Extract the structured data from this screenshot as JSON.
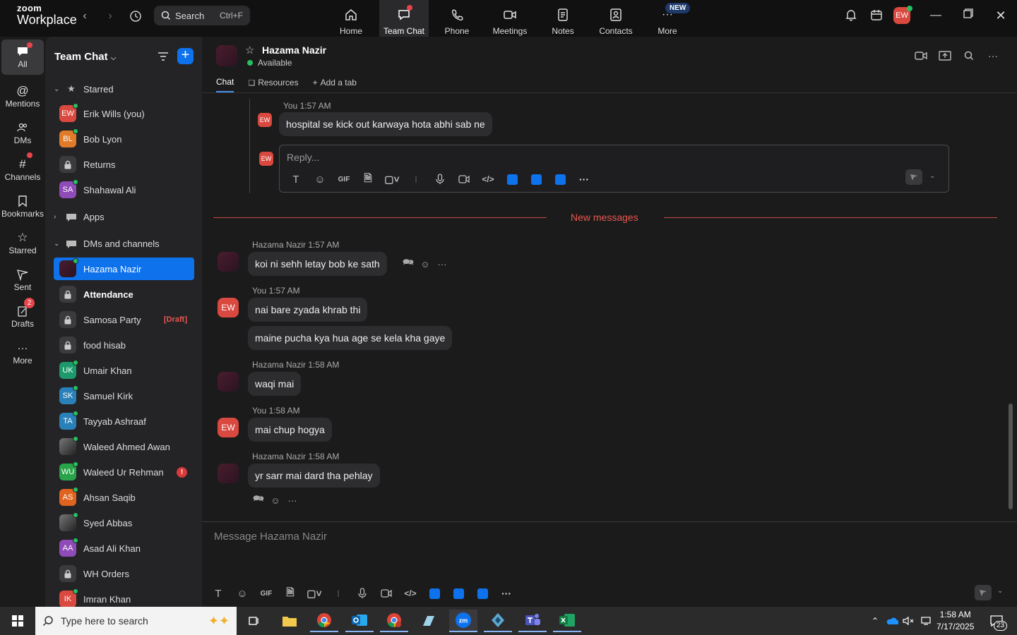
{
  "app": {
    "logo_line1": "zoom",
    "logo_line2": "Workplace"
  },
  "topbar": {
    "search_label": "Search",
    "search_shortcut": "Ctrl+F",
    "tabs": [
      {
        "label": "Home",
        "icon": "home-icon"
      },
      {
        "label": "Team Chat",
        "icon": "chat-icon"
      },
      {
        "label": "Phone",
        "icon": "phone-icon"
      },
      {
        "label": "Meetings",
        "icon": "video-icon"
      },
      {
        "label": "Notes",
        "icon": "notes-icon"
      },
      {
        "label": "Contacts",
        "icon": "contacts-icon"
      },
      {
        "label": "More",
        "icon": "more-icon"
      }
    ],
    "new_badge": "NEW",
    "user_initials": "EW"
  },
  "rail": {
    "items": [
      {
        "label": "All",
        "icon": "chat-bubble-icon"
      },
      {
        "label": "Mentions",
        "icon": "at-icon"
      },
      {
        "label": "DMs",
        "icon": "people-icon"
      },
      {
        "label": "Channels",
        "icon": "hash-icon"
      },
      {
        "label": "Bookmarks",
        "icon": "bookmark-icon"
      },
      {
        "label": "Starred",
        "icon": "star-icon"
      },
      {
        "label": "Sent",
        "icon": "send-icon"
      },
      {
        "label": "Drafts",
        "icon": "draft-icon"
      },
      {
        "label": "More",
        "icon": "ellipsis-icon"
      }
    ],
    "drafts_count": "2"
  },
  "sidebar": {
    "title": "Team Chat",
    "sections": {
      "starred": "Starred",
      "apps": "Apps",
      "dms": "DMs and channels"
    },
    "starred_items": [
      {
        "label": "Erik Wills (you)",
        "initials": "EW",
        "color": "#d9493f"
      },
      {
        "label": "Bob Lyon",
        "initials": "BL",
        "color": "#e07b2a"
      },
      {
        "label": "Returns",
        "initials": "",
        "color": "#3b3b3e"
      },
      {
        "label": "Shahawal Ali",
        "initials": "SA",
        "color": "#8f4bb8"
      }
    ],
    "dm_items": [
      {
        "label": "Hazama Nazir",
        "initials": "",
        "color": "#4a1d2e"
      },
      {
        "label": "Attendance",
        "initials": "",
        "color": "#3b3b3e"
      },
      {
        "label": "Samosa Party",
        "initials": "",
        "color": "#3b3b3e",
        "tag": "[Draft]"
      },
      {
        "label": "food hisab",
        "initials": "",
        "color": "#3b3b3e"
      },
      {
        "label": "Umair Khan",
        "initials": "UK",
        "color": "#1d9a6c"
      },
      {
        "label": "Samuel Kirk",
        "initials": "SK",
        "color": "#2a80b9"
      },
      {
        "label": "Tayyab Ashraaf",
        "initials": "TA",
        "color": "#2a80b9"
      },
      {
        "label": "Waleed Ahmed Awan",
        "initials": "",
        "color": "#555"
      },
      {
        "label": "Waleed Ur Rehman",
        "initials": "WU",
        "color": "#29a34a",
        "alert": "!"
      },
      {
        "label": "Ahsan Saqib",
        "initials": "AS",
        "color": "#e0641f"
      },
      {
        "label": "Syed Abbas",
        "initials": "",
        "color": "#333"
      },
      {
        "label": "Asad Ali Khan",
        "initials": "AA",
        "color": "#8f4bb8"
      },
      {
        "label": "WH Orders",
        "initials": "",
        "color": "#3b3b3e"
      },
      {
        "label": "Imran Khan",
        "initials": "IK",
        "color": "#d9493f"
      }
    ]
  },
  "chat": {
    "name": "Hazama Nazir",
    "status": "Available",
    "tabs": {
      "chat": "Chat",
      "resources": "Resources",
      "add": "Add a tab"
    },
    "thread_meta": "You 1:57 AM",
    "thread_msg": "hospital se kick out karwaya hota abhi sab ne",
    "reply_placeholder": "Reply...",
    "gif_label": "GIF",
    "new_messages": "New messages",
    "messages": [
      {
        "meta": "Hazama Nazir 1:57 AM",
        "text": "koi ni sehh letay bob ke sath"
      },
      {
        "meta": "You 1:57 AM",
        "text": "nai bare zyada khrab thi"
      },
      {
        "text": "maine pucha kya hua age se kela kha gaye"
      },
      {
        "meta": "Hazama Nazir 1:58 AM",
        "text": "waqi mai"
      },
      {
        "meta": "You 1:58 AM",
        "text": "mai chup hogya"
      },
      {
        "meta": "Hazama Nazir 1:58 AM",
        "text": "yr sarr mai dard tha pehlay"
      }
    ],
    "avatar_initials": "EW",
    "composer_placeholder": "Message Hazama Nazir"
  },
  "taskbar": {
    "search_placeholder": "Type here to search",
    "time": "1:58 AM",
    "date": "7/17/2025",
    "notif_count": "23"
  }
}
